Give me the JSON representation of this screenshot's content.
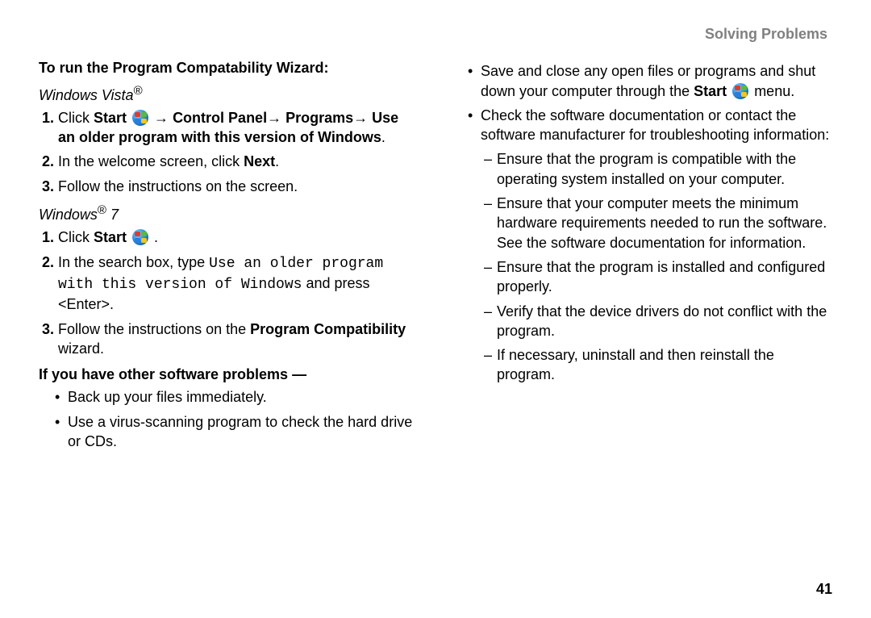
{
  "header": {
    "title": "Solving Problems"
  },
  "page_number": "41",
  "left": {
    "section1_title": "To run the Program Compatability Wizard:",
    "vista_heading_base": "Windows Vista",
    "vista_steps": {
      "s1": {
        "pre": "Click ",
        "start": "Start",
        "arrow1": " → ",
        "cp": "Control Panel",
        "arrow2": "→ ",
        "prog": "Programs",
        "arrow3": "→ ",
        "rest": "Use an older program with this version of Windows",
        "dot": "."
      },
      "s2": {
        "pre": "In the welcome screen, click ",
        "next": "Next",
        "dot": "."
      },
      "s3": "Follow the instructions on the screen."
    },
    "win7_heading_base": "Windows",
    "win7_heading_num": " 7",
    "win7_steps": {
      "s1": {
        "pre": "Click ",
        "start": "Start",
        "dot": " ."
      },
      "s2": {
        "pre": "In the search box, type ",
        "mono": "Use an older program with this version of Windows",
        "post": " and press <Enter>."
      },
      "s3": {
        "pre": "Follow the instructions on the ",
        "bold": "Program Compatibility",
        "post": " wizard."
      }
    },
    "section2_title": "If you have other software problems —",
    "other_bullets": {
      "b1": "Back up your files immediately.",
      "b2": "Use a virus-scanning program to check the hard drive or CDs."
    }
  },
  "right": {
    "bullets": {
      "b1": {
        "pre": "Save and close any open files or programs and shut down your computer through the ",
        "start": "Start",
        "post": "  menu."
      },
      "b2": "Check the software documentation or contact the software manufacturer for troubleshooting information:"
    },
    "dashes": {
      "d1": "Ensure that the program is compatible with the operating system installed on your computer.",
      "d2": "Ensure that your computer meets the minimum hardware requirements needed to run the software. See the software documentation for information.",
      "d3": "Ensure that the program is installed and configured properly.",
      "d4": "Verify that the device drivers do not conflict with the program.",
      "d5": "If necessary, uninstall and then reinstall the program."
    }
  }
}
